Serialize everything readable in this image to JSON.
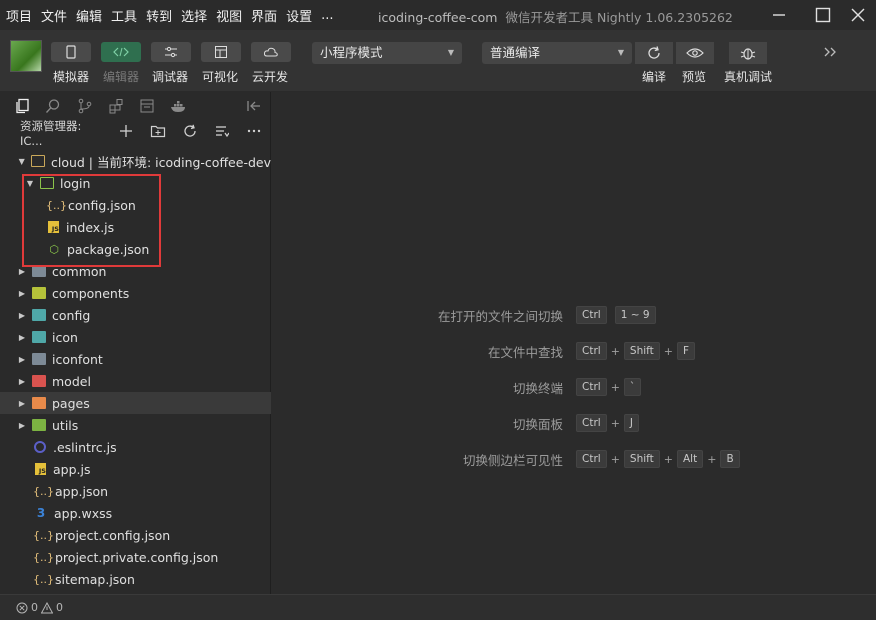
{
  "menu": [
    "项目",
    "文件",
    "编辑",
    "工具",
    "转到",
    "选择",
    "视图",
    "界面",
    "设置",
    "..."
  ],
  "window": {
    "title": "icoding-coffee-com",
    "subtitle": "微信开发者工具 Nightly 1.06.2305262"
  },
  "toolbar": {
    "simulator_label": "模拟器",
    "editor_label": "编辑器",
    "debugger_label": "调试器",
    "visual_label": "可视化",
    "cloud_label": "云开发",
    "mode_select": "小程序模式",
    "compile_select": "普通编译",
    "compile_label": "编译",
    "preview_label": "预览",
    "realdebug_label": "真机调试"
  },
  "sidebar": {
    "header_title": "资源管理器: IC...",
    "root_label": "cloud | 当前环境: icoding-coffee-dev",
    "tree": [
      {
        "label": "login"
      },
      {
        "label": "config.json"
      },
      {
        "label": "index.js"
      },
      {
        "label": "package.json"
      },
      {
        "label": "common"
      },
      {
        "label": "components"
      },
      {
        "label": "config"
      },
      {
        "label": "icon"
      },
      {
        "label": "iconfont"
      },
      {
        "label": "model"
      },
      {
        "label": "pages"
      },
      {
        "label": "utils"
      },
      {
        "label": ".eslintrc.js"
      },
      {
        "label": "app.js"
      },
      {
        "label": "app.json"
      },
      {
        "label": "app.wxss"
      },
      {
        "label": "project.config.json"
      },
      {
        "label": "project.private.config.json"
      },
      {
        "label": "sitemap.json"
      }
    ]
  },
  "shortcuts": [
    {
      "label": "在打开的文件之间切换",
      "keys": [
        "Ctrl",
        "1 ~ 9"
      ]
    },
    {
      "label": "在文件中查找",
      "keys": [
        "Ctrl",
        "Shift",
        "F"
      ]
    },
    {
      "label": "切换终端",
      "keys": [
        "Ctrl",
        "`"
      ]
    },
    {
      "label": "切换面板",
      "keys": [
        "Ctrl",
        "J"
      ]
    },
    {
      "label": "切换侧边栏可见性",
      "keys": [
        "Ctrl",
        "Shift",
        "Alt",
        "B"
      ]
    }
  ],
  "status": {
    "errors": "0",
    "warnings": "0"
  }
}
